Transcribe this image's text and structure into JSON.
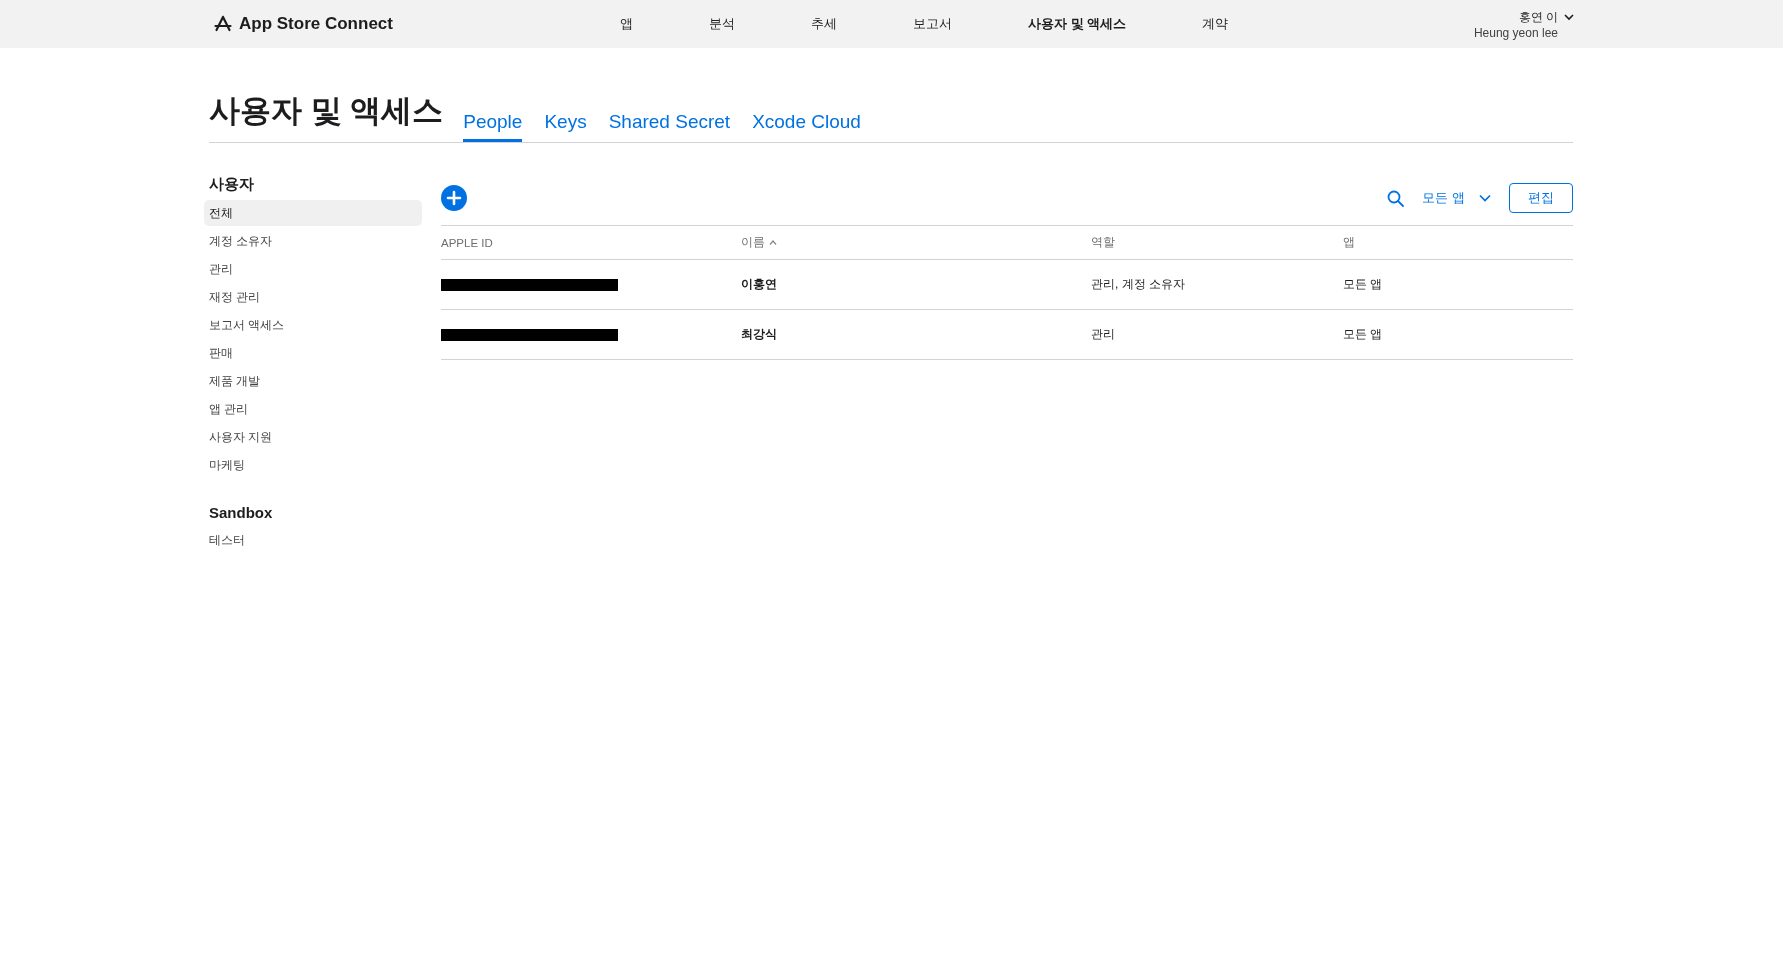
{
  "header": {
    "brand": "App Store Connect",
    "nav": [
      {
        "label": "앱",
        "selected": false
      },
      {
        "label": "분석",
        "selected": false
      },
      {
        "label": "추세",
        "selected": false
      },
      {
        "label": "보고서",
        "selected": false
      },
      {
        "label": "사용자 및 액세스",
        "selected": true
      },
      {
        "label": "계약",
        "selected": false
      }
    ],
    "user": {
      "name": "홍연 이",
      "full_name": "Heung yeon lee"
    }
  },
  "page": {
    "title": "사용자 및 액세스",
    "tabs": [
      {
        "label": "People",
        "selected": true
      },
      {
        "label": "Keys",
        "selected": false
      },
      {
        "label": "Shared Secret",
        "selected": false
      },
      {
        "label": "Xcode Cloud",
        "selected": false
      }
    ]
  },
  "sidebar": {
    "sections": [
      {
        "heading": "사용자",
        "items": [
          {
            "label": "전체",
            "selected": true
          },
          {
            "label": "계정 소유자",
            "selected": false
          },
          {
            "label": "관리",
            "selected": false
          },
          {
            "label": "재정 관리",
            "selected": false
          },
          {
            "label": "보고서 액세스",
            "selected": false
          },
          {
            "label": "판매",
            "selected": false
          },
          {
            "label": "제품 개발",
            "selected": false
          },
          {
            "label": "앱 관리",
            "selected": false
          },
          {
            "label": "사용자 지원",
            "selected": false
          },
          {
            "label": "마케팅",
            "selected": false
          }
        ]
      },
      {
        "heading": "Sandbox",
        "items": [
          {
            "label": "테스터",
            "selected": false
          }
        ]
      }
    ]
  },
  "toolbar": {
    "filter": "모든 앱",
    "edit_button": "편집"
  },
  "table": {
    "columns": [
      {
        "label": "APPLE ID",
        "sorted": false
      },
      {
        "label": "이름",
        "sorted": true
      },
      {
        "label": "역할",
        "sorted": false
      },
      {
        "label": "앱",
        "sorted": false
      }
    ],
    "rows": [
      {
        "apple_id_redacted": true,
        "name": "이홍연",
        "role": "관리, 계정 소유자",
        "apps": "모든 앱"
      },
      {
        "apple_id_redacted": true,
        "name": "최강식",
        "role": "관리",
        "apps": "모든 앱"
      }
    ]
  }
}
